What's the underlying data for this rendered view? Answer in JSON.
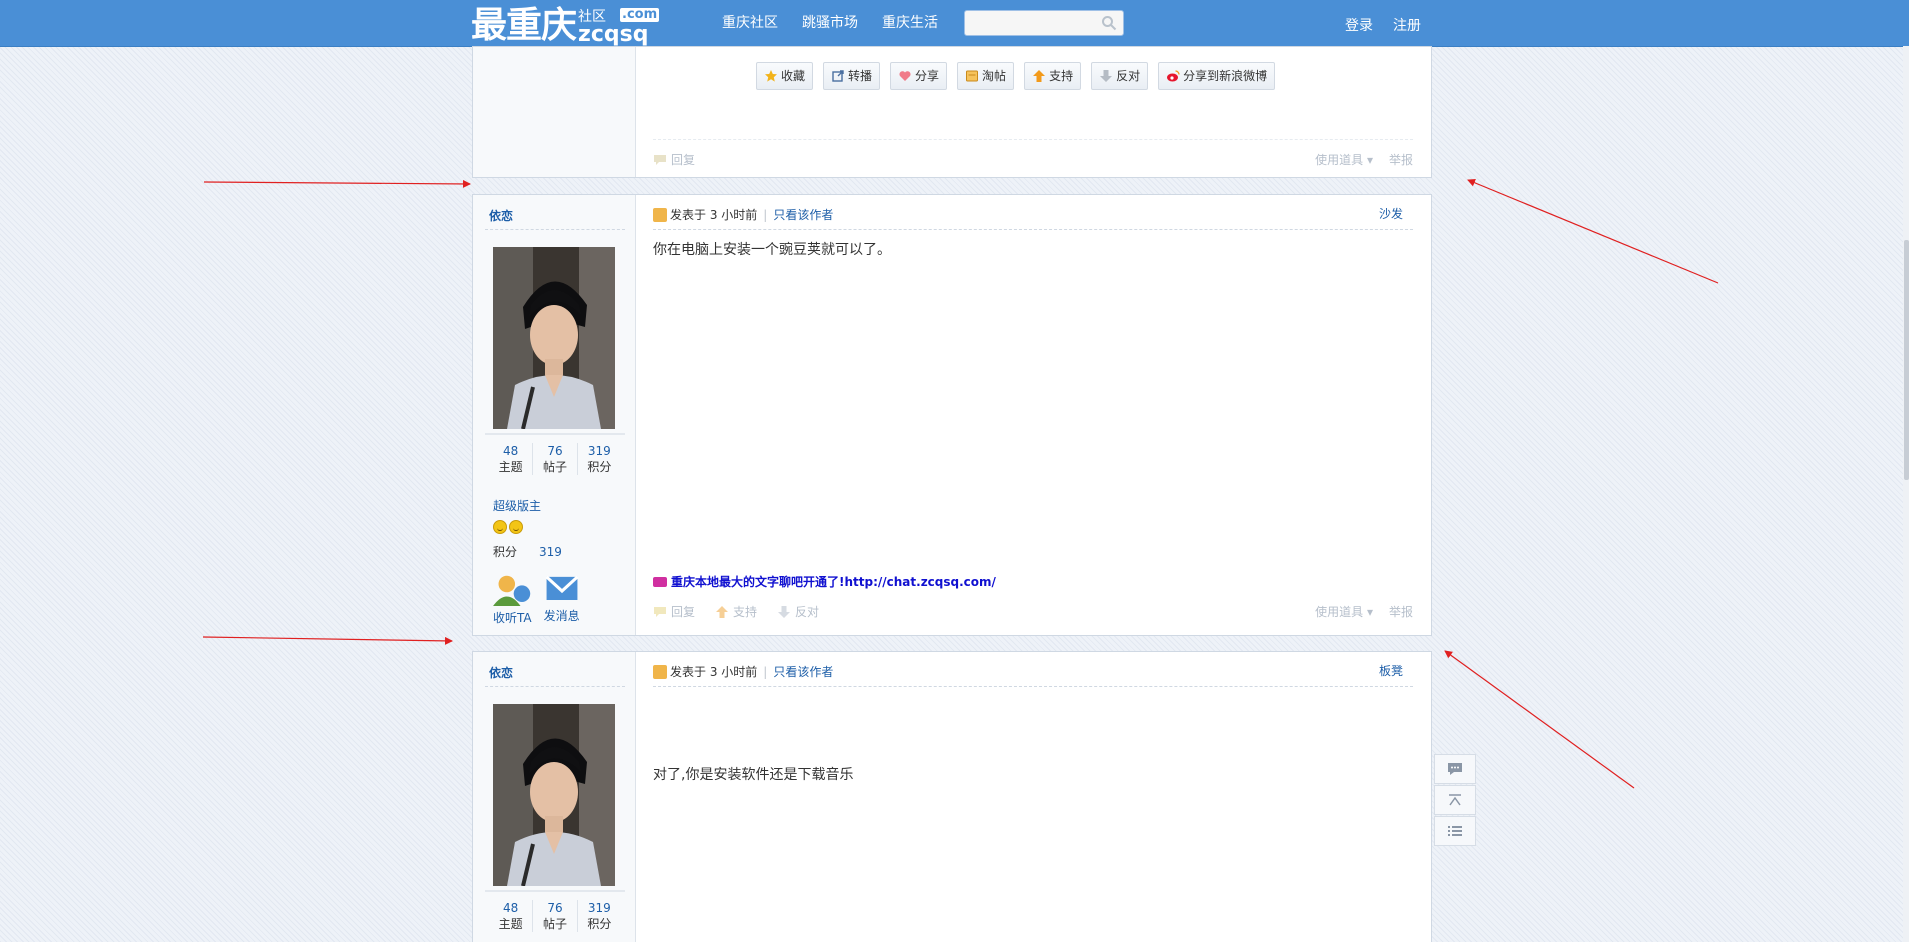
{
  "header": {
    "logo_main": "最重庆",
    "logo_small": "社区",
    "logo_com": ".com",
    "logo_en": "zcqsq",
    "nav": [
      "重庆社区",
      "跳骚市场",
      "重庆生活"
    ],
    "search_placeholder": "",
    "login": "登录",
    "register": "注册"
  },
  "top_post": {
    "buttons": [
      "收藏",
      "转播",
      "分享",
      "淘帖",
      "支持",
      "反对",
      "分享到新浪微博"
    ],
    "reply": "回复",
    "use_tool": "使用道具",
    "report": "举报"
  },
  "posts": [
    {
      "author": "依恋",
      "stats": [
        {
          "num": "48",
          "label": "主题"
        },
        {
          "num": "76",
          "label": "帖子"
        },
        {
          "num": "319",
          "label": "积分"
        }
      ],
      "rank": "超级版主",
      "points_label": "积分",
      "points": "319",
      "follow": "收听TA",
      "message": "发消息",
      "posted_at": "发表于 3 小时前",
      "only_author": "只看该作者",
      "floor": "沙发",
      "content": "你在电脑上安装一个豌豆荚就可以了。",
      "ad": "重庆本地最大的文字聊吧开通了!http://chat.zcqsq.com/",
      "reply": "回复",
      "support": "支持",
      "oppose": "反对",
      "use_tool": "使用道具",
      "report": "举报"
    },
    {
      "author": "依恋",
      "stats": [
        {
          "num": "48",
          "label": "主题"
        },
        {
          "num": "76",
          "label": "帖子"
        },
        {
          "num": "319",
          "label": "积分"
        }
      ],
      "posted_at": "发表于 3 小时前",
      "only_author": "只看该作者",
      "floor": "板凳",
      "content": "对了,你是安装软件还是下载音乐"
    }
  ],
  "colors": {
    "header_bg": "#4a8fd6",
    "link": "#1d5ea8",
    "annotation_arrow": "#e02020"
  }
}
